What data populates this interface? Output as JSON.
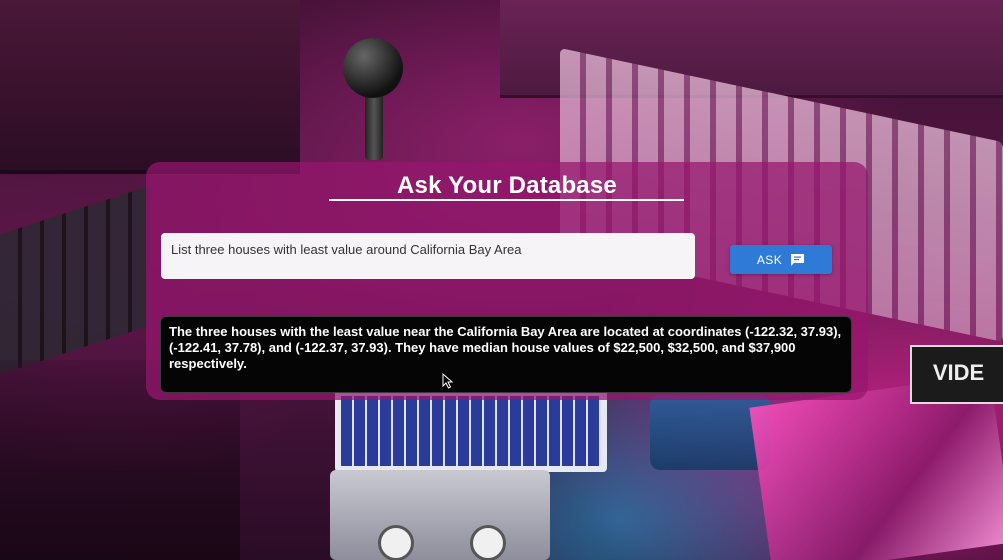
{
  "app": {
    "title": "Ask Your Database"
  },
  "query": {
    "value": "List three houses with least value around California Bay Area"
  },
  "ask_button": {
    "label": "ASK",
    "icon": "chat-icon"
  },
  "answer": {
    "text": "The three houses with the least value near the California Bay Area are located at coordinates (-122.32, 37.93), (-122.41, 37.78), and (-122.37, 37.93). They have median house values of $22,500, $32,500, and $37,900 respectively."
  },
  "background": {
    "sign_text": "VIDE"
  },
  "colors": {
    "panel": "#96166e",
    "button": "#2f7ad6",
    "answer_bg": "#050505"
  }
}
